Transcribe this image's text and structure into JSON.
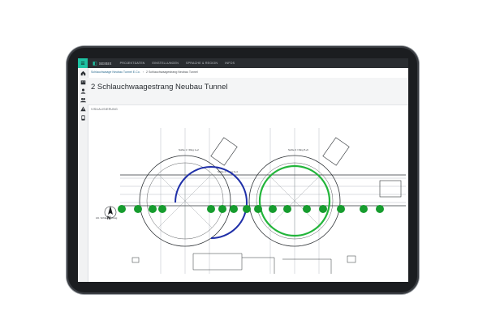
{
  "app": {
    "brand": "SEIBIX",
    "nav": [
      "PROJEKTDATEN",
      "EINSTELLUNGEN",
      "SPRACHE & REGION",
      "INFOS"
    ]
  },
  "breadcrumb": {
    "items": [
      "Schlauchwaage Neubau Tunnel E.Co.",
      "2 Schlauchwaagestrang Neubau Tunnel"
    ]
  },
  "page": {
    "title": "2 Schlauchwaagestrang Neubau Tunnel",
    "section": "VISUALISIERUNG"
  },
  "sidebar": {
    "icons": [
      "home-icon",
      "building-icon",
      "user-icon",
      "users-icon",
      "warning-icon",
      "device-icon"
    ]
  },
  "drawing": {
    "north_label": "N",
    "legend_label": "Lbl. Schlauchstrang",
    "sections": [
      "Sohle 1 / Ring 1+2",
      "Sohle 2 / Ring 3+4",
      "Sohle 3 / Ring 5+6"
    ],
    "sensor_ring_left_color": "#1f2fa8",
    "sensor_ring_right_color": "#22b53a",
    "sensor_dot_color": "#169c2e",
    "sensor_count": 16
  },
  "colors": {
    "accent": "#1ec2a3",
    "topbar": "#2a2d31"
  }
}
